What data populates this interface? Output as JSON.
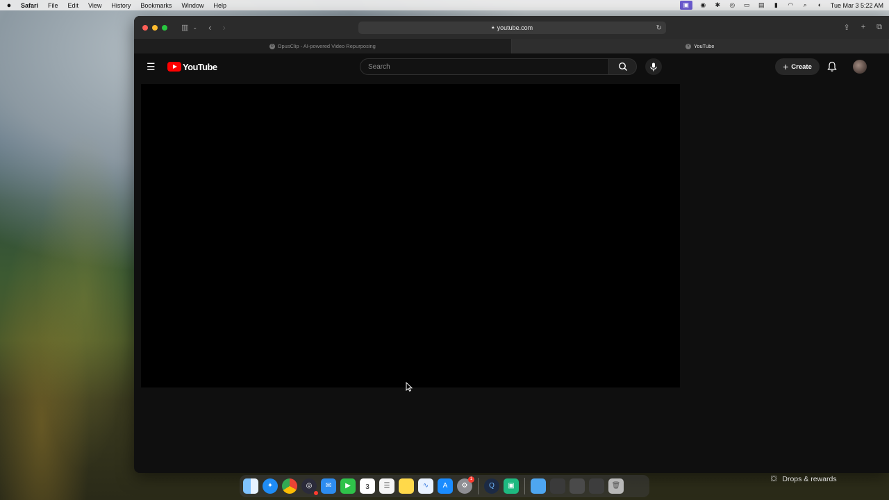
{
  "menubar": {
    "app_name": "Safari",
    "items": [
      "File",
      "Edit",
      "View",
      "History",
      "Bookmarks",
      "Window",
      "Help"
    ],
    "clock": "Tue Mar 3  5:22 AM"
  },
  "browser": {
    "url": "youtube.com",
    "tabs": [
      {
        "title": "OpusClip - AI-powered Video Repurposing",
        "favicon": "O"
      },
      {
        "title": "YouTube",
        "favicon": "Y"
      }
    ]
  },
  "youtube": {
    "logo_text": "YouTube",
    "search": {
      "placeholder": "Search",
      "value": ""
    },
    "create_label": "Create"
  },
  "dock": {
    "calendar_day": "3",
    "settings_badge": "1"
  },
  "notification": {
    "label": "Drops & rewards"
  },
  "colors": {
    "yt_red": "#ff0000",
    "page_bg": "#0f0f0f",
    "player_bg": "#000000"
  }
}
